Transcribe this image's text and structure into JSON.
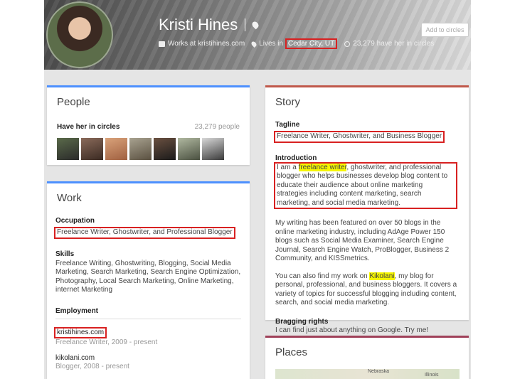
{
  "profile": {
    "name": "Kristi Hines",
    "works_at": "Works at kristihines.com",
    "lives_in_prefix": "Lives in",
    "lives_in_city": "Cedar City, UT",
    "circles": "23,279 have her in circles",
    "add_button": "Add to circles"
  },
  "people": {
    "title": "People",
    "have_her_label": "Have her in circles",
    "count": "23,279 people"
  },
  "work": {
    "title": "Work",
    "occupation_label": "Occupation",
    "occupation_value": "Freelance Writer, Ghostwriter, and Professional Blogger",
    "skills_label": "Skills",
    "skills_value": "Freelance Writing, Ghostwriting, Blogging, Social Media Marketing, Search Marketing, Search Engine Optimization, Photography, Local Search Marketing, Online Marketing, internet Marketing",
    "employment_label": "Employment",
    "employers": [
      {
        "name": "kristihines.com",
        "detail": "Freelance Writer, 2009 - present"
      },
      {
        "name": "kikolani.com",
        "detail": "Blogger, 2008 - present"
      }
    ]
  },
  "story": {
    "title": "Story",
    "tagline_label": "Tagline",
    "tagline_value": "Freelance Writer, Ghostwriter, and Business Blogger",
    "intro_label": "Introduction",
    "intro_pre": "I am a ",
    "intro_highlight": "freelance writer",
    "intro_post": ", ghostwriter, and professional blogger who helps businesses develop blog content to educate their audience about online marketing strategies including content marketing, search marketing, and social media marketing.",
    "para2": "My writing has been featured on over 50 blogs in the online marketing industry, including AdAge Power 150 blogs such as Social Media Examiner, Search Engine Journal, Search Engine Watch, ProBlogger, Business 2 Community, and KISSmetrics.",
    "para3_pre": "You can also find my work on ",
    "para3_highlight": "Kikolani",
    "para3_post": ", my blog for personal, professional, and business bloggers. It covers a variety of topics for successful blogging including content, search, and social media marketing.",
    "bragging_label": "Bragging rights",
    "bragging_value": "I can find just about anything on Google. Try me!"
  },
  "places": {
    "title": "Places",
    "map_labels": [
      "Nebraska",
      "Illinois"
    ]
  },
  "colors": {
    "people_bar": "#4d90fe",
    "work_bar": "#4d90fe",
    "story_bar": "#c0584a",
    "places_bar": "#a0415a",
    "highlight_box": "#d82121"
  }
}
